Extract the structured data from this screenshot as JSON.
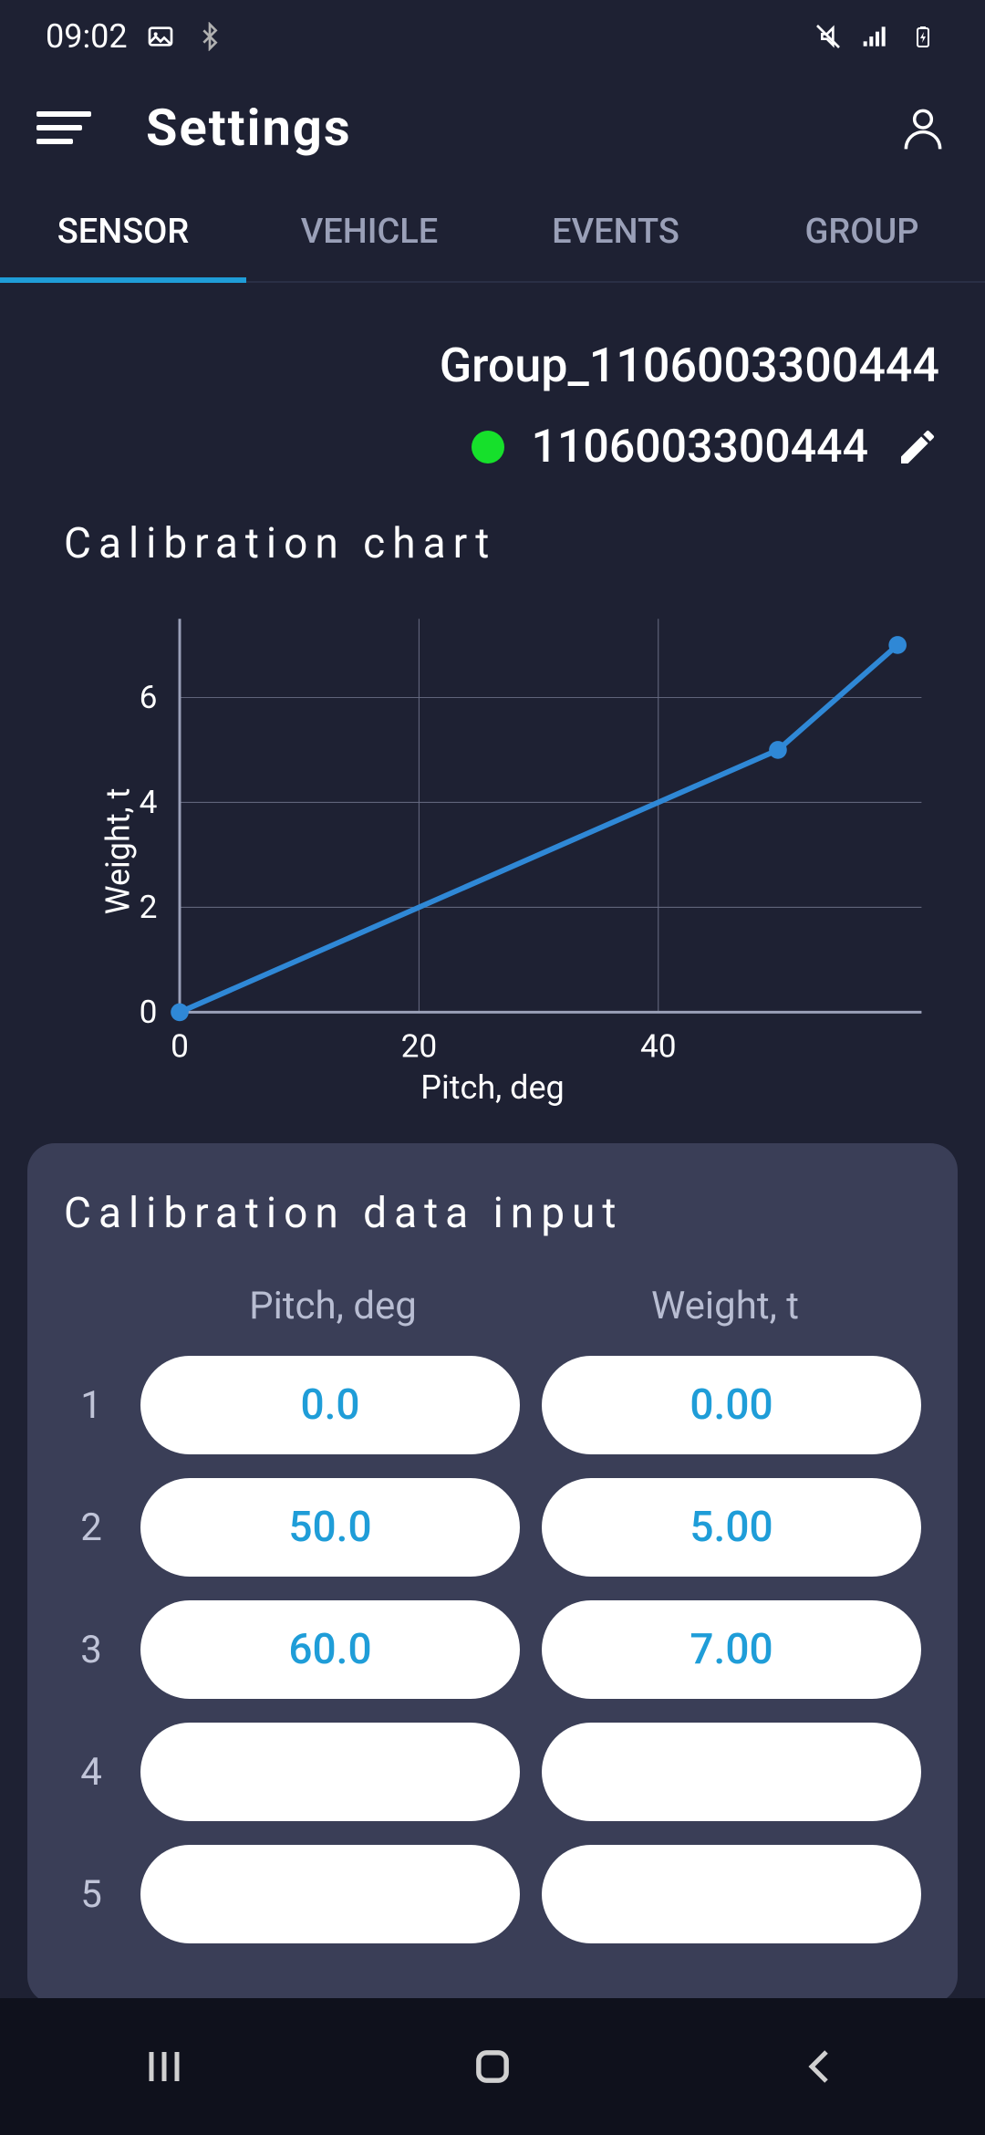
{
  "status_bar": {
    "time": "09:02",
    "icons_left": [
      "image-icon",
      "bluetooth-icon"
    ],
    "icons_right": [
      "vibration-icon",
      "signal-icon",
      "battery-charging-icon"
    ]
  },
  "app_bar": {
    "title": "Settings"
  },
  "tabs": [
    {
      "id": "sensor",
      "label": "SENSOR",
      "active": true
    },
    {
      "id": "vehicle",
      "label": "VEHICLE",
      "active": false
    },
    {
      "id": "events",
      "label": "EVENTS",
      "active": false
    },
    {
      "id": "group",
      "label": "GROUP",
      "active": false
    }
  ],
  "group": {
    "name": "Group_1106003300444",
    "sensor_id": "1106003300444",
    "status_color": "#16e02b"
  },
  "sections": {
    "chart_title": "Calibration chart",
    "input_title": "Calibration data input"
  },
  "chart_data": {
    "type": "line",
    "xlabel": "Pitch, deg",
    "ylabel": "Weight, t",
    "x_ticks": [
      0,
      20,
      40
    ],
    "y_ticks": [
      0,
      2,
      4,
      6
    ],
    "xlim": [
      0,
      62
    ],
    "ylim": [
      0,
      7.5
    ],
    "series": [
      {
        "name": "calibration",
        "color": "#2f88d6",
        "points": [
          {
            "x": 0,
            "y": 0
          },
          {
            "x": 50,
            "y": 5
          },
          {
            "x": 60,
            "y": 7
          }
        ]
      }
    ]
  },
  "table": {
    "columns": [
      {
        "id": "pitch",
        "label": "Pitch, deg"
      },
      {
        "id": "weight",
        "label": "Weight, t"
      }
    ],
    "rows": [
      {
        "num": "1",
        "pitch": "0.0",
        "weight": "0.00"
      },
      {
        "num": "2",
        "pitch": "50.0",
        "weight": "5.00"
      },
      {
        "num": "3",
        "pitch": "60.0",
        "weight": "7.00"
      },
      {
        "num": "4",
        "pitch": "",
        "weight": ""
      },
      {
        "num": "5",
        "pitch": "",
        "weight": ""
      }
    ]
  }
}
